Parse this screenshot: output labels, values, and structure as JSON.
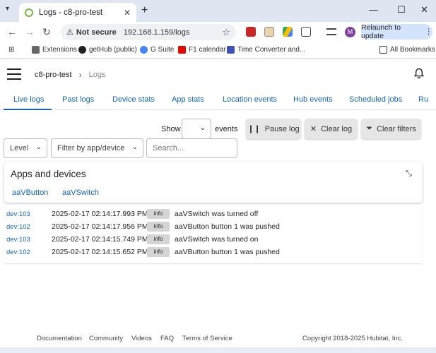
{
  "browser": {
    "tab_title": "Logs - c8-pro-test",
    "not_secure": "Not secure",
    "url": "192.168.1.159/logs",
    "relaunch": "Relaunch to update",
    "profile_initial": "M"
  },
  "bookmarks": {
    "extensions": "Extensions",
    "github": "getHub (public)",
    "gsuite": "G Suite",
    "f1": "F1 calendar",
    "timeconv": "Time Converter and...",
    "all": "All Bookmarks"
  },
  "header": {
    "hub_name": "c8-pro-test",
    "current_page": "Logs"
  },
  "tabs": [
    {
      "label": "Live logs"
    },
    {
      "label": "Past logs"
    },
    {
      "label": "Device stats"
    },
    {
      "label": "App stats"
    },
    {
      "label": "Location events"
    },
    {
      "label": "Hub events"
    },
    {
      "label": "Scheduled jobs"
    },
    {
      "label": "Ru"
    }
  ],
  "controls": {
    "show": "Show",
    "events": "events",
    "pause": "Pause log",
    "clear_log": "Clear log",
    "clear_filters": "Clear filters",
    "level": "Level",
    "filter_app": "Filter by app/device",
    "search_placeholder": "Search..."
  },
  "devices_card": {
    "title": "Apps and devices",
    "items": [
      "aaVButton",
      "aaVSwitch"
    ]
  },
  "logs": [
    {
      "dev": "dev:103",
      "time": "2025-02-17 02:14:17.993 PM",
      "level": "info",
      "msg": "aaVSwitch was turned off"
    },
    {
      "dev": "dev:102",
      "time": "2025-02-17 02:14:17.956 PM",
      "level": "info",
      "msg": "aaVButton button 1 was pushed"
    },
    {
      "dev": "dev:103",
      "time": "2025-02-17 02:14:15.749 PM",
      "level": "info",
      "msg": "aaVSwitch was turned on"
    },
    {
      "dev": "dev:102",
      "time": "2025-02-17 02:14:15.652 PM",
      "level": "info",
      "msg": "aaVButton button 1 was pushed"
    }
  ],
  "footer": {
    "documentation": "Documentation",
    "community": "Community",
    "videos": "Videos",
    "faq": "FAQ",
    "terms": "Terms of Service",
    "copyright": "Copyright 2018-2025 Hubitat, Inc."
  },
  "colors": {
    "accent": "#1565c0",
    "button_bg": "#e6e6e6",
    "level_badge_bg": "#d4d4d4"
  }
}
